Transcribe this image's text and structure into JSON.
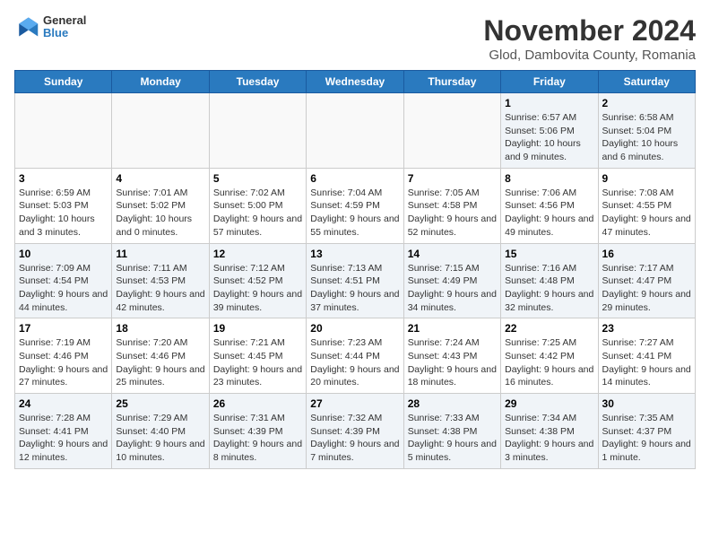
{
  "header": {
    "logo_line1": "General",
    "logo_line2": "Blue",
    "title": "November 2024",
    "subtitle": "Glod, Dambovita County, Romania"
  },
  "days_of_week": [
    "Sunday",
    "Monday",
    "Tuesday",
    "Wednesday",
    "Thursday",
    "Friday",
    "Saturday"
  ],
  "weeks": [
    [
      {
        "day": "",
        "info": ""
      },
      {
        "day": "",
        "info": ""
      },
      {
        "day": "",
        "info": ""
      },
      {
        "day": "",
        "info": ""
      },
      {
        "day": "",
        "info": ""
      },
      {
        "day": "1",
        "info": "Sunrise: 6:57 AM\nSunset: 5:06 PM\nDaylight: 10 hours and 9 minutes."
      },
      {
        "day": "2",
        "info": "Sunrise: 6:58 AM\nSunset: 5:04 PM\nDaylight: 10 hours and 6 minutes."
      }
    ],
    [
      {
        "day": "3",
        "info": "Sunrise: 6:59 AM\nSunset: 5:03 PM\nDaylight: 10 hours and 3 minutes."
      },
      {
        "day": "4",
        "info": "Sunrise: 7:01 AM\nSunset: 5:02 PM\nDaylight: 10 hours and 0 minutes."
      },
      {
        "day": "5",
        "info": "Sunrise: 7:02 AM\nSunset: 5:00 PM\nDaylight: 9 hours and 57 minutes."
      },
      {
        "day": "6",
        "info": "Sunrise: 7:04 AM\nSunset: 4:59 PM\nDaylight: 9 hours and 55 minutes."
      },
      {
        "day": "7",
        "info": "Sunrise: 7:05 AM\nSunset: 4:58 PM\nDaylight: 9 hours and 52 minutes."
      },
      {
        "day": "8",
        "info": "Sunrise: 7:06 AM\nSunset: 4:56 PM\nDaylight: 9 hours and 49 minutes."
      },
      {
        "day": "9",
        "info": "Sunrise: 7:08 AM\nSunset: 4:55 PM\nDaylight: 9 hours and 47 minutes."
      }
    ],
    [
      {
        "day": "10",
        "info": "Sunrise: 7:09 AM\nSunset: 4:54 PM\nDaylight: 9 hours and 44 minutes."
      },
      {
        "day": "11",
        "info": "Sunrise: 7:11 AM\nSunset: 4:53 PM\nDaylight: 9 hours and 42 minutes."
      },
      {
        "day": "12",
        "info": "Sunrise: 7:12 AM\nSunset: 4:52 PM\nDaylight: 9 hours and 39 minutes."
      },
      {
        "day": "13",
        "info": "Sunrise: 7:13 AM\nSunset: 4:51 PM\nDaylight: 9 hours and 37 minutes."
      },
      {
        "day": "14",
        "info": "Sunrise: 7:15 AM\nSunset: 4:49 PM\nDaylight: 9 hours and 34 minutes."
      },
      {
        "day": "15",
        "info": "Sunrise: 7:16 AM\nSunset: 4:48 PM\nDaylight: 9 hours and 32 minutes."
      },
      {
        "day": "16",
        "info": "Sunrise: 7:17 AM\nSunset: 4:47 PM\nDaylight: 9 hours and 29 minutes."
      }
    ],
    [
      {
        "day": "17",
        "info": "Sunrise: 7:19 AM\nSunset: 4:46 PM\nDaylight: 9 hours and 27 minutes."
      },
      {
        "day": "18",
        "info": "Sunrise: 7:20 AM\nSunset: 4:46 PM\nDaylight: 9 hours and 25 minutes."
      },
      {
        "day": "19",
        "info": "Sunrise: 7:21 AM\nSunset: 4:45 PM\nDaylight: 9 hours and 23 minutes."
      },
      {
        "day": "20",
        "info": "Sunrise: 7:23 AM\nSunset: 4:44 PM\nDaylight: 9 hours and 20 minutes."
      },
      {
        "day": "21",
        "info": "Sunrise: 7:24 AM\nSunset: 4:43 PM\nDaylight: 9 hours and 18 minutes."
      },
      {
        "day": "22",
        "info": "Sunrise: 7:25 AM\nSunset: 4:42 PM\nDaylight: 9 hours and 16 minutes."
      },
      {
        "day": "23",
        "info": "Sunrise: 7:27 AM\nSunset: 4:41 PM\nDaylight: 9 hours and 14 minutes."
      }
    ],
    [
      {
        "day": "24",
        "info": "Sunrise: 7:28 AM\nSunset: 4:41 PM\nDaylight: 9 hours and 12 minutes."
      },
      {
        "day": "25",
        "info": "Sunrise: 7:29 AM\nSunset: 4:40 PM\nDaylight: 9 hours and 10 minutes."
      },
      {
        "day": "26",
        "info": "Sunrise: 7:31 AM\nSunset: 4:39 PM\nDaylight: 9 hours and 8 minutes."
      },
      {
        "day": "27",
        "info": "Sunrise: 7:32 AM\nSunset: 4:39 PM\nDaylight: 9 hours and 7 minutes."
      },
      {
        "day": "28",
        "info": "Sunrise: 7:33 AM\nSunset: 4:38 PM\nDaylight: 9 hours and 5 minutes."
      },
      {
        "day": "29",
        "info": "Sunrise: 7:34 AM\nSunset: 4:38 PM\nDaylight: 9 hours and 3 minutes."
      },
      {
        "day": "30",
        "info": "Sunrise: 7:35 AM\nSunset: 4:37 PM\nDaylight: 9 hours and 1 minute."
      }
    ]
  ]
}
